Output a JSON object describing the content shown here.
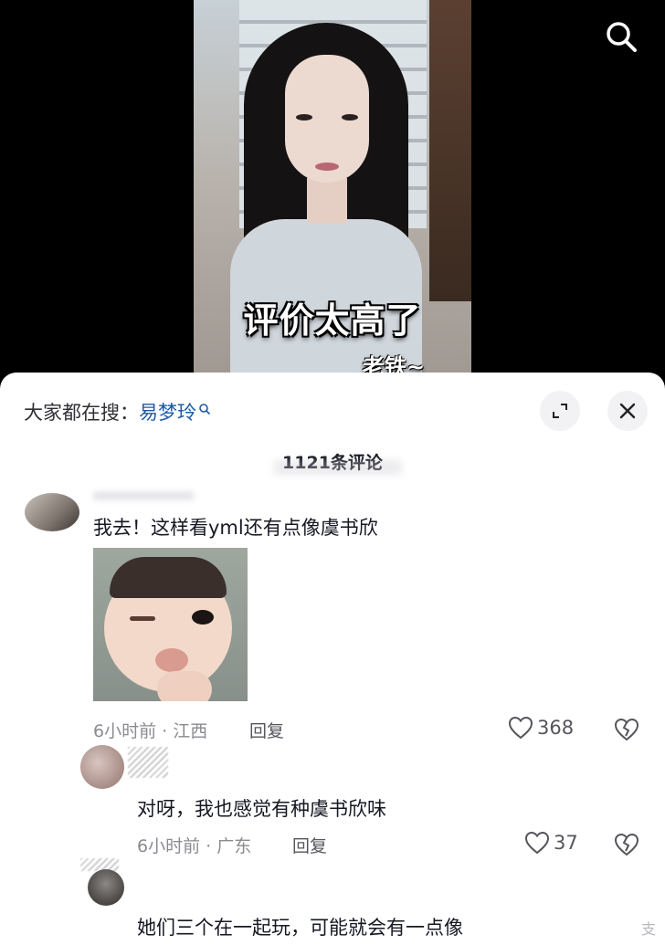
{
  "video": {
    "caption_main": "评价太高了",
    "caption_sub": "老铁~"
  },
  "sheet": {
    "hot_search_prefix": "大家都在搜：",
    "hot_search_keyword": "易梦玲",
    "comment_count": "1121条评论"
  },
  "comments": [
    {
      "text": "我去！这样看yml还有点像虞书欣",
      "time_location": "6小时前 · 江西",
      "reply_label": "回复",
      "likes": "368"
    },
    {
      "text": "对呀，我也感觉有种虞书欣味",
      "time_location": "6小时前 · 广东",
      "reply_label": "回复",
      "likes": "37"
    },
    {
      "text": "她们三个在一起玩，可能就会有一点像"
    }
  ],
  "watermark": "支",
  "icons": {
    "search": "search-icon",
    "expand": "expand-icon",
    "close": "close-icon",
    "heart": "heart-icon",
    "dislike": "broken-heart-icon"
  },
  "colors": {
    "keyword": "#1e5aa8",
    "meta": "#8a8b91",
    "sheet_bg": "#ffffff"
  }
}
